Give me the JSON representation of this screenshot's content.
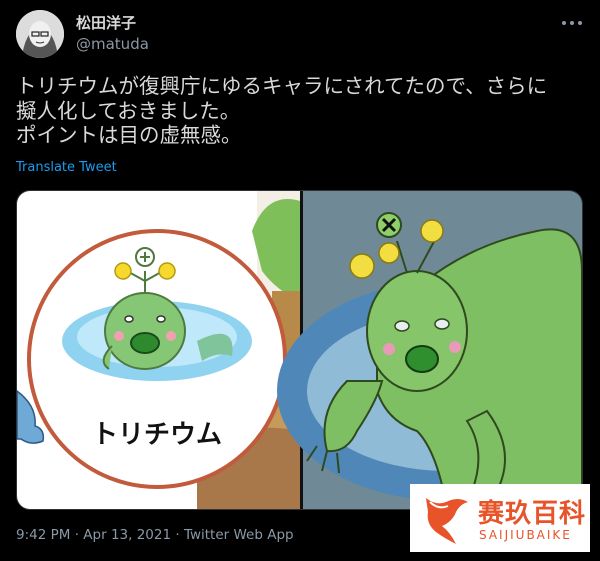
{
  "user": {
    "display_name": "松田洋子",
    "handle": "@matuda"
  },
  "tweet": {
    "lines": [
      "トリチウムが復興庁にゆるキャラにされてたので、さらに",
      "擬人化しておきました。",
      "ポイントは目の虚無感。"
    ],
    "translate_label": "Translate Tweet",
    "media": {
      "left_panel_label": "トリチウム"
    },
    "meta": {
      "time": "9:42 PM",
      "separator": "·",
      "date": "Apr 13, 2021",
      "app": "Twitter Web App"
    }
  },
  "watermark": {
    "text_cn": "赛玖百科",
    "text_en": "SAIJIUBAIKE"
  },
  "colors": {
    "background": "#000000",
    "text": "#d9d9d9",
    "secondary": "#8b98a5",
    "link": "#1d9bf0",
    "watermark": "#e8542a"
  },
  "icons": {
    "more": "more-horizontal-icon"
  }
}
